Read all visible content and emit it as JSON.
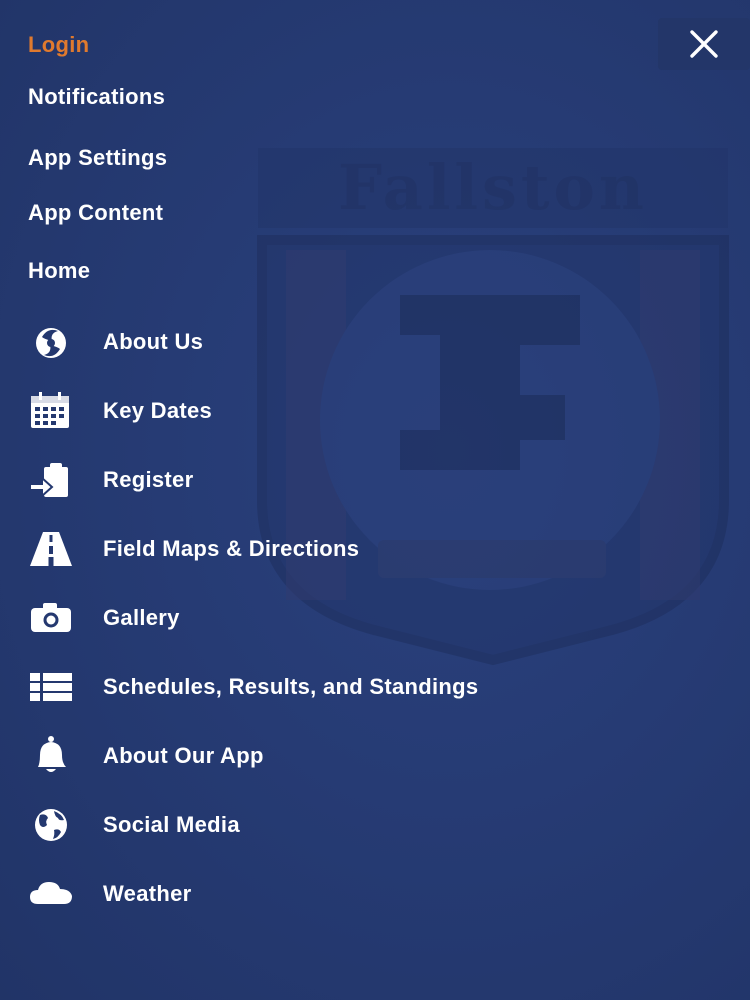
{
  "menu": {
    "login_label": "Login",
    "top_items": [
      {
        "label": "Notifications"
      },
      {
        "label": "App Settings"
      },
      {
        "label": "App Content"
      },
      {
        "label": "Home"
      }
    ],
    "items": [
      {
        "label": "About Us",
        "icon": "flame-icon"
      },
      {
        "label": "Key Dates",
        "icon": "calendar-icon"
      },
      {
        "label": "Register",
        "icon": "clipboard-icon"
      },
      {
        "label": "Field Maps & Directions",
        "icon": "road-icon"
      },
      {
        "label": "Gallery",
        "icon": "camera-icon"
      },
      {
        "label": "Schedules, Results, and Standings",
        "icon": "list-icon"
      },
      {
        "label": "About Our App",
        "icon": "bell-icon"
      },
      {
        "label": "Social Media",
        "icon": "globe-icon"
      },
      {
        "label": "Weather",
        "icon": "cloud-icon"
      }
    ]
  },
  "background": {
    "crest_text": "Fallston"
  },
  "colors": {
    "background": "#24386f",
    "accent": "#e07a2e",
    "text": "#ffffff"
  }
}
